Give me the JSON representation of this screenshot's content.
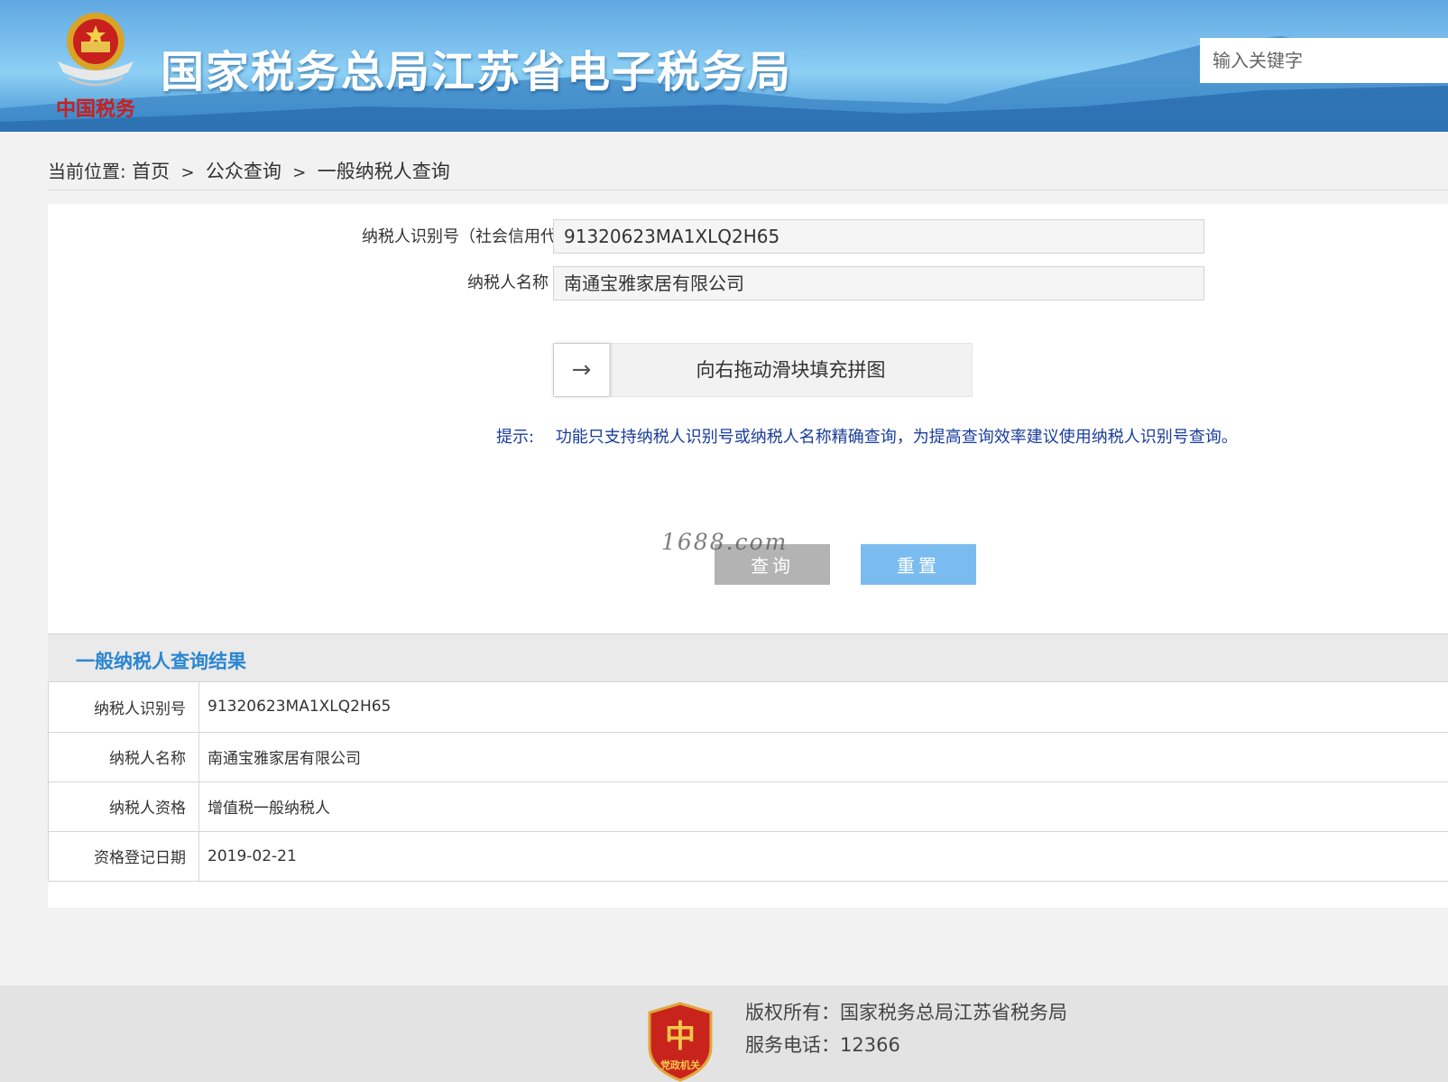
{
  "header": {
    "logo_caption": "中国税务",
    "site_title": "国家税务总局江苏省电子税务局",
    "search_placeholder": "输入关键字"
  },
  "breadcrumb": {
    "prefix": "当前位置:",
    "items": [
      "首页",
      "公众查询",
      "一般纳税人查询"
    ],
    "separator": ">"
  },
  "form": {
    "id_label": "纳税人识别号（社会信用代码）",
    "id_value": "91320623MA1XLQ2H65",
    "name_label": "纳税人名称",
    "name_value": "南通宝雅家居有限公司",
    "slider_text": "向右拖动滑块填充拼图",
    "slider_arrow": "→",
    "hint_label": "提示:",
    "hint_text": "功能只支持纳税人识别号或纳税人名称精确查询，为提高查询效率建议使用纳税人识别号查询。",
    "query_button": "查询",
    "reset_button": "重置"
  },
  "watermark": "1688.com",
  "result": {
    "title": "一般纳税人查询结果",
    "rows": [
      {
        "label": "纳税人识别号",
        "value": "91320623MA1XLQ2H65"
      },
      {
        "label": "纳税人名称",
        "value": "南通宝雅家居有限公司"
      },
      {
        "label": "纳税人资格",
        "value": "增值税一般纳税人"
      },
      {
        "label": "资格登记日期",
        "value": "2019-02-21"
      }
    ]
  },
  "footer": {
    "badge_text": "党政机关",
    "copyright": "版权所有：国家税务总局江苏省税务局",
    "phone": "服务电话：12366"
  },
  "colors": {
    "header_blue": "#5fa8e0",
    "result_title": "#2a86d1",
    "hint": "#1a3d9e",
    "reset_button": "#7bbcf0",
    "query_button": "#b3b3b3"
  }
}
